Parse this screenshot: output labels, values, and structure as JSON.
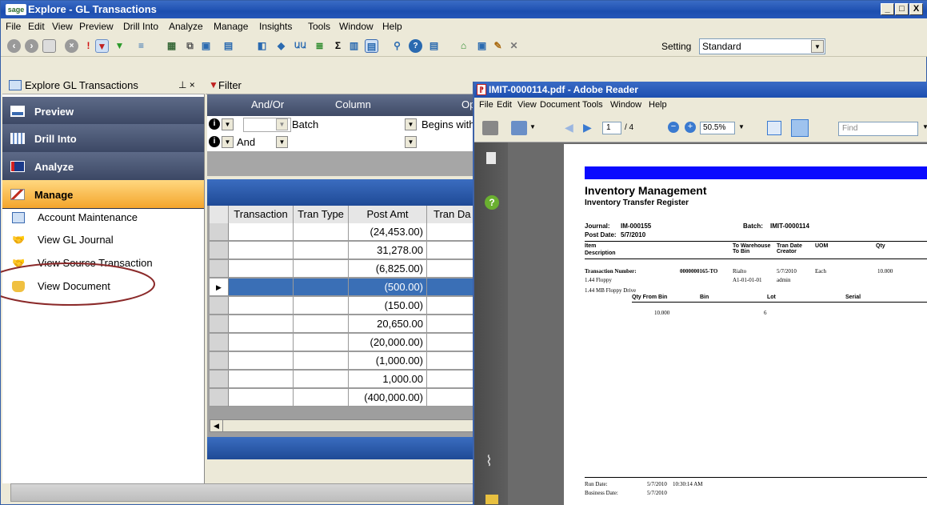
{
  "window": {
    "title": "Explore - GL Transactions",
    "logo": "sage",
    "controls": [
      "_",
      "□",
      "X"
    ]
  },
  "menu": [
    "File",
    "Edit",
    "View",
    "Preview",
    "Drill Into",
    "Analyze",
    "Manage",
    "Insights",
    "Tools",
    "Window",
    "Help"
  ],
  "toolbar": {
    "setting_label": "Setting",
    "setting_value": "Standard"
  },
  "left_panel": {
    "title": "Explore GL Transactions",
    "pin": "⊥ ×",
    "nav": [
      {
        "label": "Preview",
        "icon": "preview-icon"
      },
      {
        "label": "Drill Into",
        "icon": "drill-into-icon"
      },
      {
        "label": "Analyze",
        "icon": "analyze-icon"
      },
      {
        "label": "Manage",
        "icon": "manage-icon",
        "active": true
      }
    ],
    "items": [
      {
        "label": "Account Maintenance",
        "icon": "account-maintenance-icon"
      },
      {
        "label": "View GL Journal",
        "icon": "handshake-icon"
      },
      {
        "label": "View Source Transaction",
        "icon": "handshake-icon"
      },
      {
        "label": "View Document",
        "icon": "document-hand-icon"
      }
    ]
  },
  "filter": {
    "title": "Filter",
    "columns": [
      "And/Or",
      "Column",
      "Op"
    ],
    "rows": [
      {
        "andor": "",
        "column": "Batch",
        "op": "Begins with"
      },
      {
        "andor": "And",
        "column": "",
        "op": ""
      }
    ]
  },
  "grid": {
    "columns": [
      "Transaction",
      "Tran Type",
      "Post Amt",
      "Tran Da"
    ],
    "rows": [
      {
        "post_amt": "(24,453.00)"
      },
      {
        "post_amt": "31,278.00"
      },
      {
        "post_amt": "(6,825.00)"
      },
      {
        "post_amt": "(500.00)",
        "selected": true
      },
      {
        "post_amt": "(150.00)"
      },
      {
        "post_amt": "20,650.00"
      },
      {
        "post_amt": "(20,000.00)"
      },
      {
        "post_amt": "(1,000.00)"
      },
      {
        "post_amt": "1,000.00"
      },
      {
        "post_amt": "(400,000.00)"
      }
    ]
  },
  "reader": {
    "title": "IMIT-0000114.pdf - Adobe Reader",
    "menu": [
      "File",
      "Edit",
      "View",
      "Document",
      "Tools",
      "Window",
      "Help"
    ],
    "page_current": "1",
    "page_total": "/ 4",
    "zoom": "50.5%",
    "find_placeholder": "Find",
    "doc": {
      "title": "Inventory Management",
      "subtitle": "Inventory Transfer Register",
      "journal_label": "Journal:",
      "journal": "IM-000155",
      "batch_label": "Batch:",
      "batch": "IMIT-0000114",
      "post_date_label": "Post Date:",
      "post_date": "5/7/2010",
      "hdr_item": "Item",
      "hdr_desc": "Description",
      "hdr_to_wh": "To Warehouse",
      "hdr_to_bin": "To Bin",
      "hdr_tran_date": "Tran Date",
      "hdr_creator": "Creator",
      "hdr_uom": "UOM",
      "hdr_qty": "Qty",
      "tran_num_label": "Transaction Number:",
      "tran_num": "0000000165-TO",
      "warehouse": "Rialto",
      "tran_date": "5/7/2010",
      "uom": "Each",
      "qty": "10.000",
      "item": "1.44 Floppy",
      "bin": "A1-01-01-01",
      "creator": "admin",
      "item_desc": "1.44 MB Floppy Drive",
      "sub_qty_from_bin": "Qty From Bin",
      "sub_bin": "Bin",
      "sub_lot": "Lot",
      "sub_serial": "Serial",
      "sub_qty": "10.000",
      "sub_lot_val": "6",
      "run_date_label": "Run Date:",
      "run_date": "5/7/2010",
      "run_time": "10:30:14 AM",
      "business_date_label": "Business Date:",
      "business_date": "5/7/2010"
    }
  },
  "colors": {
    "accent": "#f4a52c",
    "nav_bar": "#4a5675",
    "highlight_circle": "#8b2a2a",
    "selected_row": "#3a6fb6",
    "title_blue": "#1d4fb0"
  }
}
